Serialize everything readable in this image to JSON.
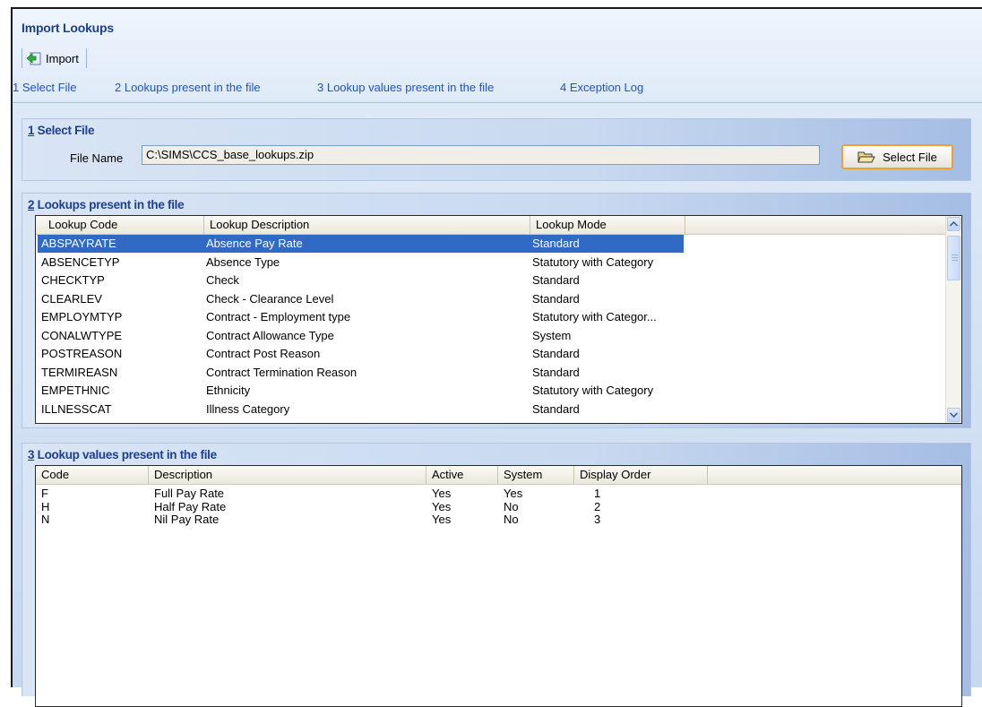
{
  "header": {
    "title": "Import Lookups",
    "toolbar": {
      "import_label": "Import"
    },
    "steps": [
      "1 Select File",
      "2 Lookups present in the file",
      "3 Lookup values present in the file",
      "4 Exception Log"
    ]
  },
  "select_file": {
    "section_num": "1",
    "section_title": " Select File",
    "file_name_label": "File Name",
    "file_name_value": "C:\\SIMS\\CCS_base_lookups.zip",
    "button_label": "Select File"
  },
  "lookups": {
    "section_num": "2",
    "section_title": " Lookups present in the file",
    "columns": [
      "Lookup Code",
      "Lookup Description",
      "Lookup Mode"
    ],
    "rows": [
      {
        "code": "ABSPAYRATE",
        "description": "Absence Pay Rate",
        "mode": "Standard",
        "selected": true
      },
      {
        "code": "ABSENCETYP",
        "description": "Absence Type",
        "mode": "Statutory with Category"
      },
      {
        "code": "CHECKTYP",
        "description": "Check",
        "mode": "Standard"
      },
      {
        "code": "CLEARLEV",
        "description": "Check - Clearance Level",
        "mode": "Standard"
      },
      {
        "code": "EMPLOYMTYP",
        "description": "Contract - Employment type",
        "mode": "Statutory with Categor..."
      },
      {
        "code": "CONALWTYPE",
        "description": "Contract Allowance Type",
        "mode": "System"
      },
      {
        "code": "POSTREASON",
        "description": "Contract Post Reason",
        "mode": "Standard"
      },
      {
        "code": "TERMIREASN",
        "description": "Contract Termination Reason",
        "mode": "Standard"
      },
      {
        "code": "EMPETHNIC",
        "description": "Ethnicity",
        "mode": "Statutory with Category"
      },
      {
        "code": "ILLNESSCAT",
        "description": "Illness Category",
        "mode": "Standard"
      }
    ]
  },
  "lookup_values": {
    "section_num": "3",
    "section_title": " Lookup values present in the file",
    "columns": [
      "Code",
      "Description",
      "Active",
      "System",
      "Display Order"
    ],
    "rows": [
      {
        "code": "F",
        "description": "Full Pay Rate",
        "active": "Yes",
        "system": "Yes",
        "order": "1"
      },
      {
        "code": "H",
        "description": "Half Pay Rate",
        "active": "Yes",
        "system": "No",
        "order": "2"
      },
      {
        "code": "N",
        "description": "Nil Pay Rate",
        "active": "Yes",
        "system": "No",
        "order": "3"
      }
    ]
  },
  "colors": {
    "title_blue": "#1d3f8f",
    "link_blue": "#1f53c8",
    "selection": "#316ac5",
    "focus_orange": "#f0a030"
  },
  "icons": [
    "import-arrow-icon",
    "folder-open-icon",
    "scroll-up-arrow-icon",
    "scroll-down-arrow-icon"
  ]
}
